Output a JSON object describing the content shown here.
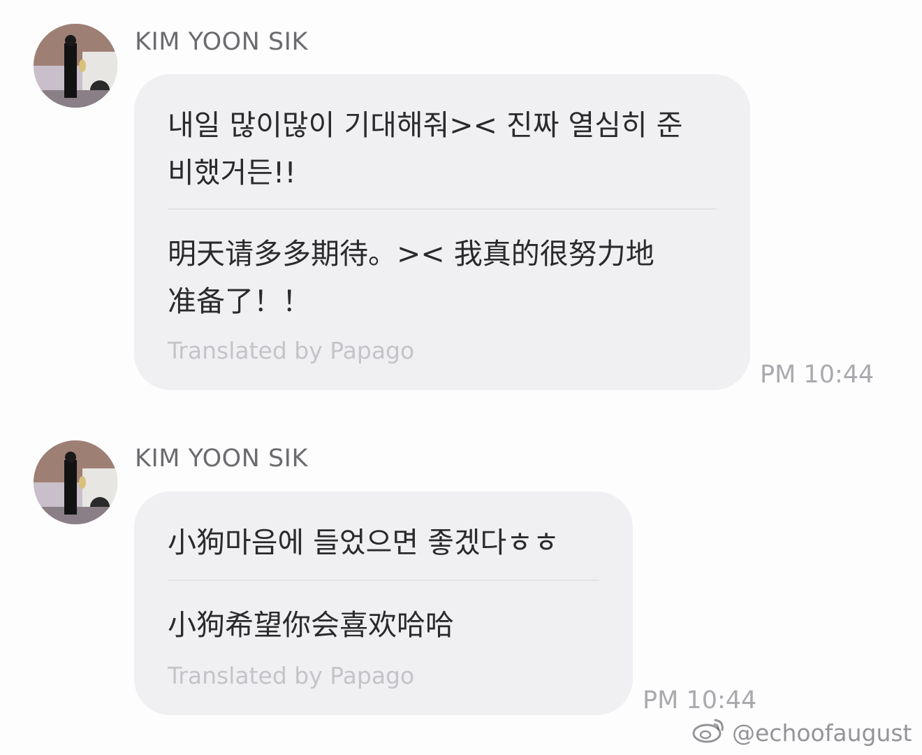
{
  "messages": [
    {
      "sender": "KIM YOON SIK",
      "original_line1": "내일 많이많이 기대해줘>< 진짜 열심히 준",
      "original_line2": "비했거든!!",
      "translated_line1": "明天请多多期待。>< 我真的很努力地",
      "translated_line2": "准备了！！",
      "translated_by": "Translated by Papago",
      "time": "PM 10:44"
    },
    {
      "sender": "KIM YOON SIK",
      "original_line1": "小狗마음에 들었으면 좋겠다ㅎㅎ",
      "translated_line1": "小狗希望你会喜欢哈哈",
      "translated_by": "Translated by Papago",
      "time": "PM 10:44"
    }
  ],
  "watermark": {
    "icon": "weibo-logo-icon",
    "handle": "@echoofaugust"
  }
}
